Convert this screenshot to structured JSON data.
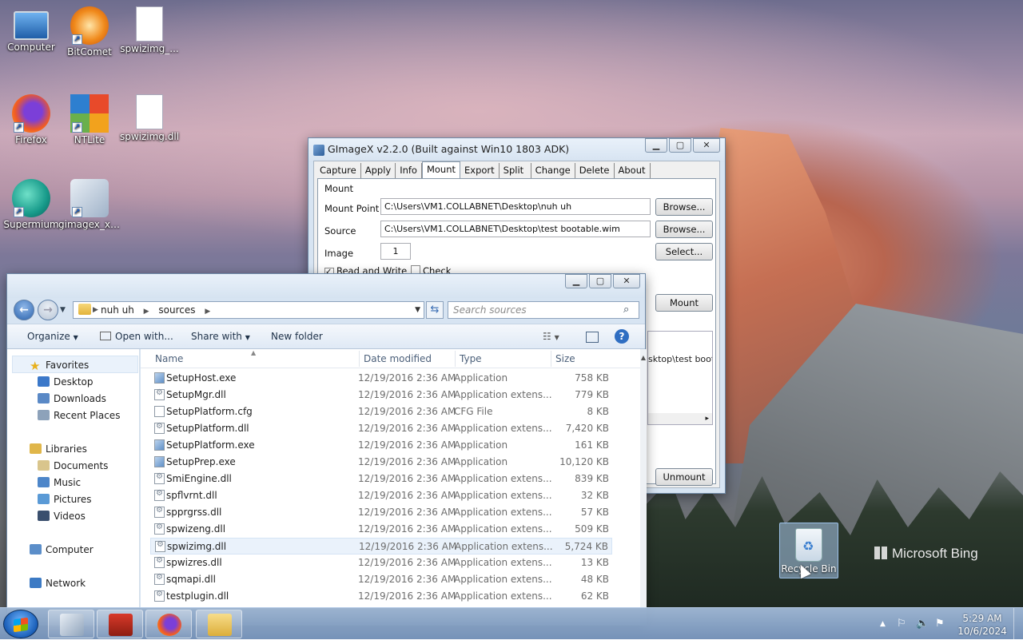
{
  "desktop": {
    "icons": [
      {
        "label": "Computer"
      },
      {
        "label": "BitComet"
      },
      {
        "label": "spwizimg_..."
      },
      {
        "label": "Firefox"
      },
      {
        "label": "NTLite"
      },
      {
        "label": "spwizimg.dll"
      },
      {
        "label": "Supermium"
      },
      {
        "label": "gimagex_x6..."
      }
    ],
    "recycle_bin": {
      "label": "Recycle Bin"
    },
    "bing": "Microsoft Bing"
  },
  "gimagex": {
    "title": "GImageX v2.2.0 (Built against Win10 1803 ADK)",
    "tabs": [
      "Capture",
      "Apply",
      "Info",
      "Mount",
      "Export",
      "Split",
      "Change",
      "Delete",
      "About"
    ],
    "active_tab": "Mount",
    "group": "Mount",
    "mount_point_label": "Mount Point",
    "mount_point_value": "C:\\Users\\VM1.COLLABNET\\Desktop\\nuh uh",
    "source_label": "Source",
    "source_value": "C:\\Users\\VM1.COLLABNET\\Desktop\\test bootable.wim",
    "image_label": "Image",
    "image_value": "1",
    "read_write_label": "Read and Write",
    "read_write_checked": true,
    "check_label": "Check",
    "check_checked": false,
    "browse_label": "Browse...",
    "browse2_label": "Browse...",
    "select_label": "Select...",
    "mount_button": "Mount",
    "unmount_button": "Unmount",
    "list_text": "sktop\\test boota"
  },
  "explorer": {
    "breadcrumb": [
      "nuh uh",
      "sources"
    ],
    "search_placeholder": "Search sources",
    "toolbar": {
      "organize": "Organize",
      "open_with": "Open with...",
      "share_with": "Share with",
      "new_folder": "New folder"
    },
    "nav": {
      "favorites": "Favorites",
      "desktop": "Desktop",
      "downloads": "Downloads",
      "recent": "Recent Places",
      "libraries": "Libraries",
      "documents": "Documents",
      "music": "Music",
      "pictures": "Pictures",
      "videos": "Videos",
      "computer": "Computer",
      "network": "Network"
    },
    "columns": {
      "name": "Name",
      "date": "Date modified",
      "type": "Type",
      "size": "Size"
    },
    "files": [
      {
        "name": "SetupHost.exe",
        "date": "12/19/2016 2:36 AM",
        "type": "Application",
        "size": "758 KB"
      },
      {
        "name": "SetupMgr.dll",
        "date": "12/19/2016 2:36 AM",
        "type": "Application extens...",
        "size": "779 KB"
      },
      {
        "name": "SetupPlatform.cfg",
        "date": "12/19/2016 2:36 AM",
        "type": "CFG File",
        "size": "8 KB"
      },
      {
        "name": "SetupPlatform.dll",
        "date": "12/19/2016 2:36 AM",
        "type": "Application extens...",
        "size": "7,420 KB"
      },
      {
        "name": "SetupPlatform.exe",
        "date": "12/19/2016 2:36 AM",
        "type": "Application",
        "size": "161 KB"
      },
      {
        "name": "SetupPrep.exe",
        "date": "12/19/2016 2:36 AM",
        "type": "Application",
        "size": "10,120 KB"
      },
      {
        "name": "SmiEngine.dll",
        "date": "12/19/2016 2:36 AM",
        "type": "Application extens...",
        "size": "839 KB"
      },
      {
        "name": "spflvrnt.dll",
        "date": "12/19/2016 2:36 AM",
        "type": "Application extens...",
        "size": "32 KB"
      },
      {
        "name": "spprgrss.dll",
        "date": "12/19/2016 2:36 AM",
        "type": "Application extens...",
        "size": "57 KB"
      },
      {
        "name": "spwizeng.dll",
        "date": "12/19/2016 2:36 AM",
        "type": "Application extens...",
        "size": "509 KB"
      },
      {
        "name": "spwizimg.dll",
        "date": "12/19/2016 2:36 AM",
        "type": "Application extens...",
        "size": "5,724 KB"
      },
      {
        "name": "spwizres.dll",
        "date": "12/19/2016 2:36 AM",
        "type": "Application extens...",
        "size": "13 KB"
      },
      {
        "name": "sqmapi.dll",
        "date": "12/19/2016 2:36 AM",
        "type": "Application extens...",
        "size": "48 KB"
      },
      {
        "name": "testplugin.dll",
        "date": "12/19/2016 2:36 AM",
        "type": "Application extens...",
        "size": "62 KB"
      }
    ],
    "selected_file": "spwizimg.dll"
  },
  "taskbar": {
    "time": "5:29 AM",
    "date": "10/6/2024"
  }
}
